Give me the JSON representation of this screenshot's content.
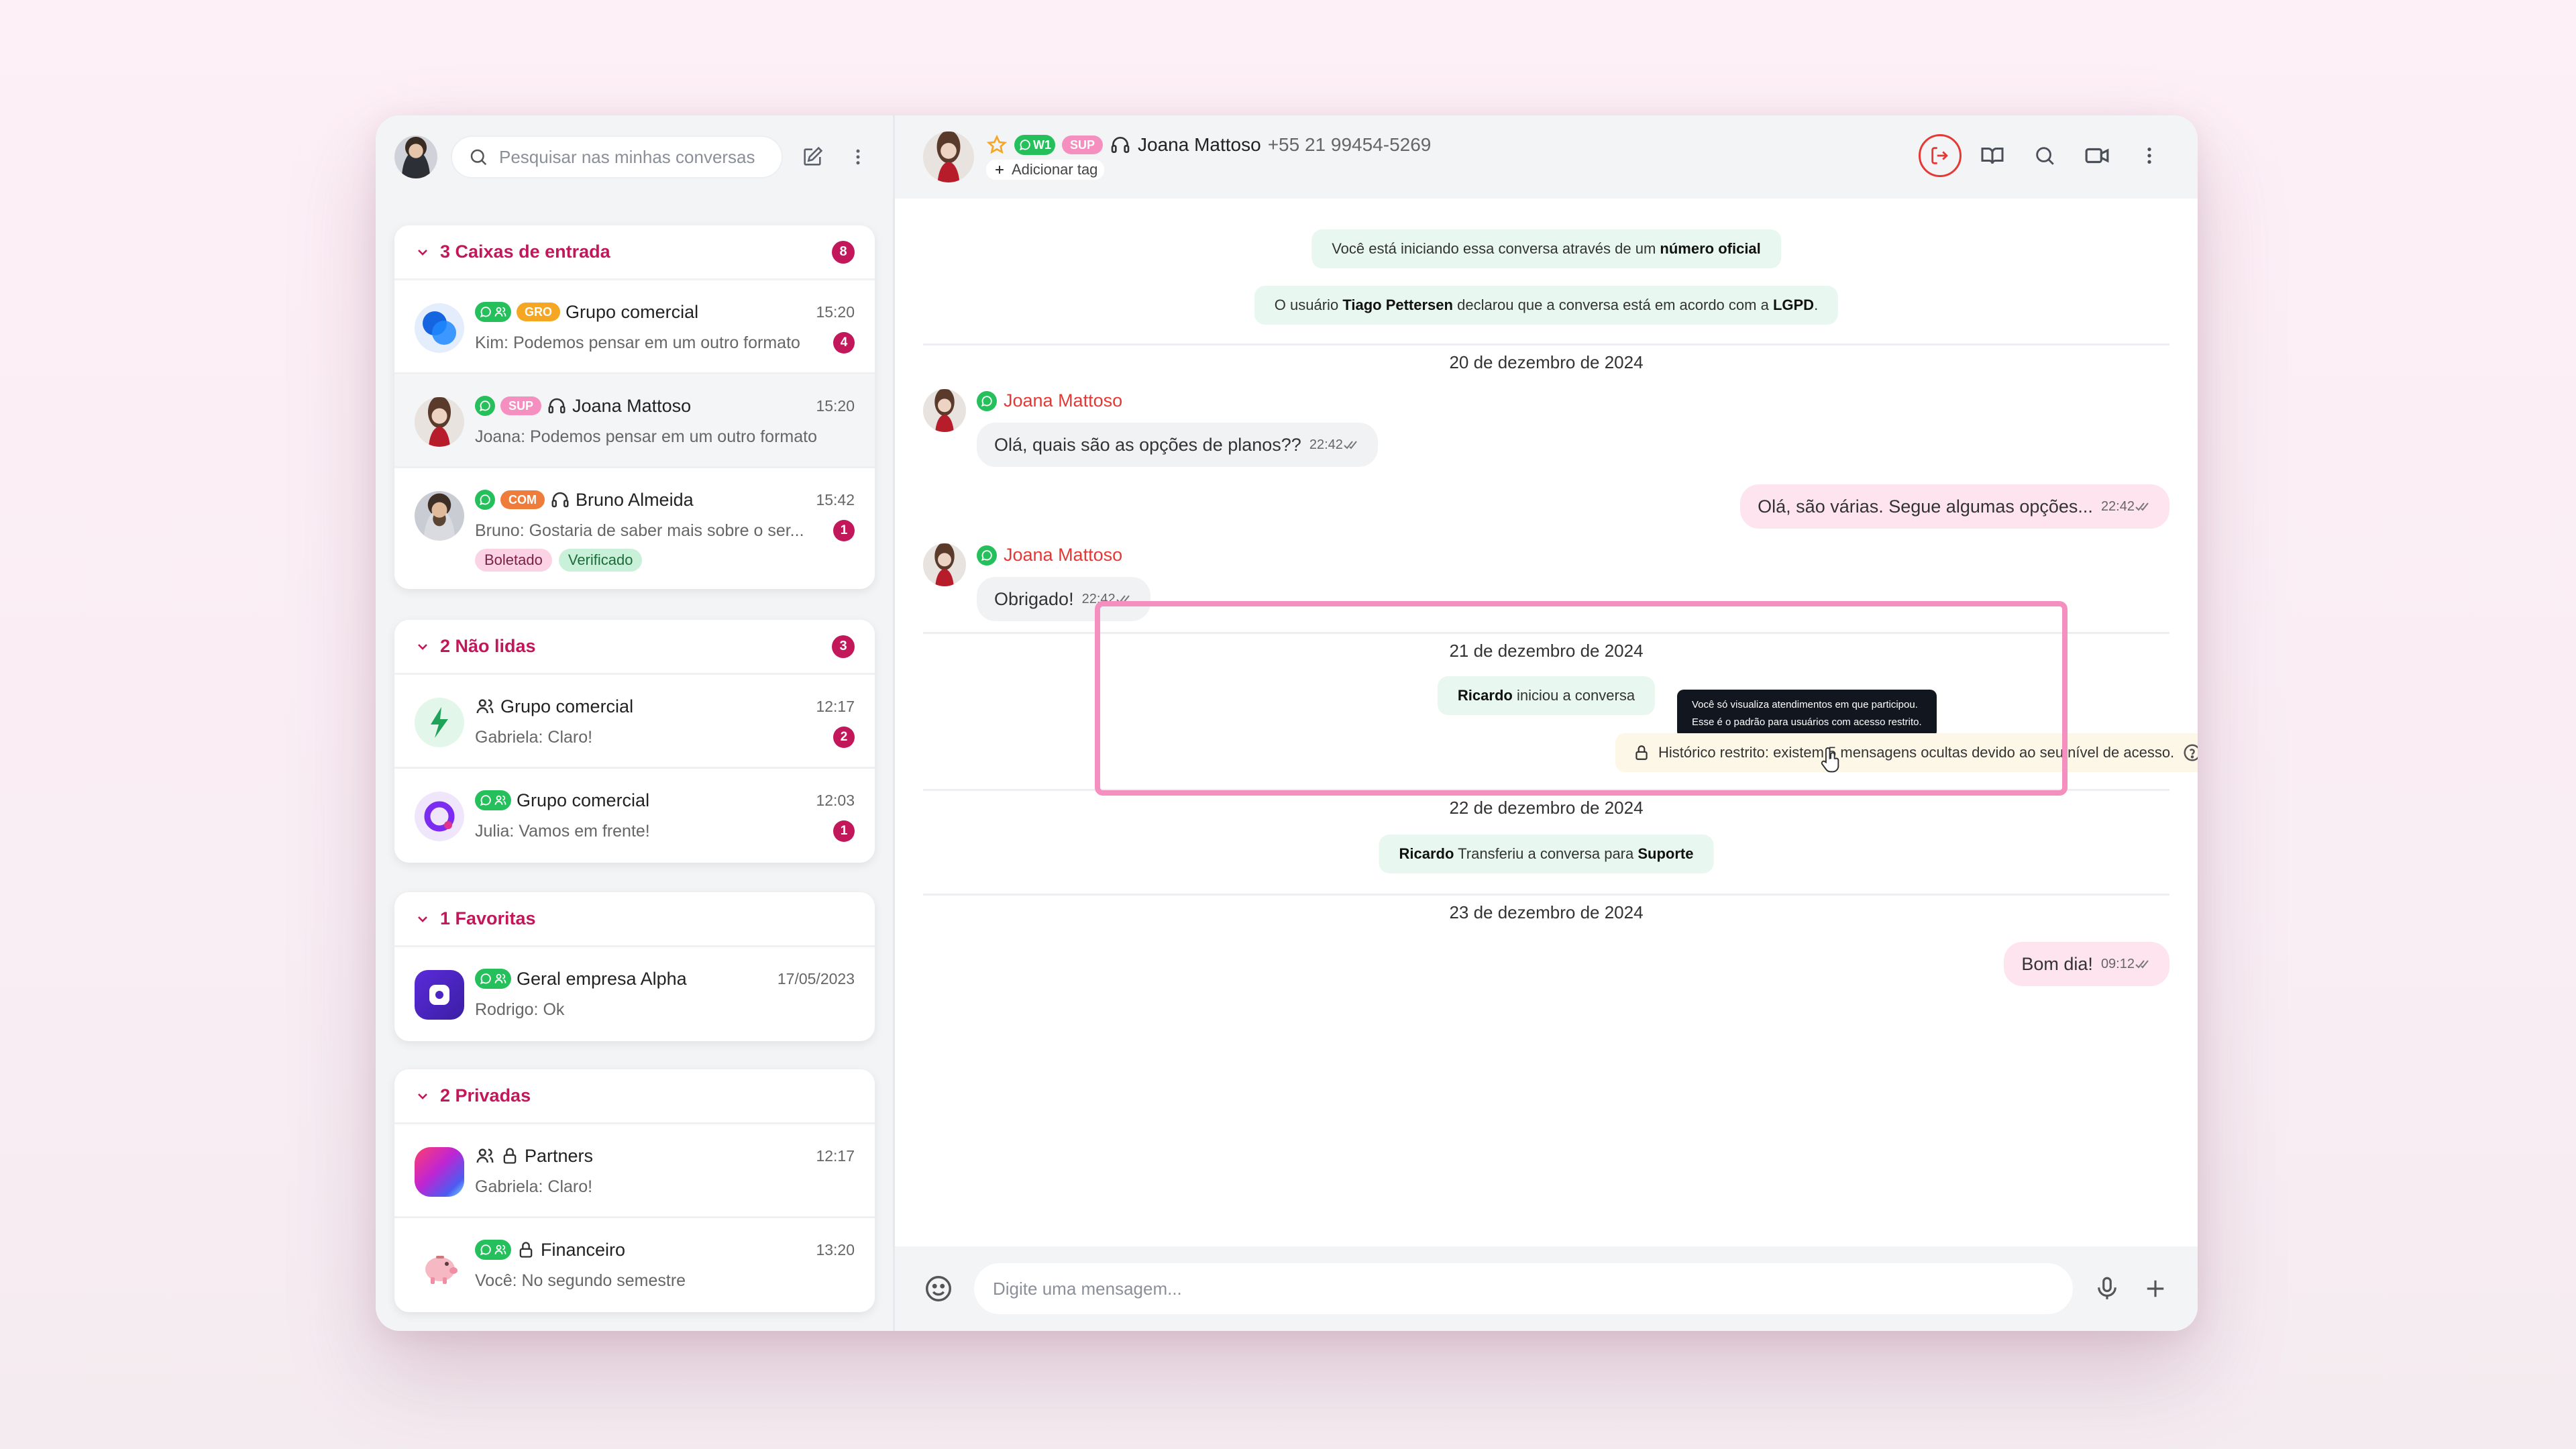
{
  "sidebar": {
    "search_placeholder": "Pesquisar nas minhas conversas",
    "groups": [
      {
        "title": "3 Caixas de entrada",
        "count": "8",
        "items": [
          {
            "name": "Grupo comercial",
            "time": "15:20",
            "preview": "Kim: Podemos pensar em um outro formato",
            "count": "4",
            "tag": "GRO"
          },
          {
            "name": "Joana Mattoso",
            "time": "15:20",
            "preview": "Joana: Podemos pensar em um outro formato",
            "tag": "SUP"
          },
          {
            "name": "Bruno Almeida",
            "time": "15:42",
            "preview": "Bruno: Gostaria de saber mais sobre o ser...",
            "count": "1",
            "tag": "COM",
            "chips": [
              "Boletado",
              "Verificado"
            ]
          }
        ]
      },
      {
        "title": "2 Não lidas",
        "count": "3",
        "items": [
          {
            "name": "Grupo comercial",
            "time": "12:17",
            "preview": "Gabriela: Claro!",
            "count": "2"
          },
          {
            "name": "Grupo comercial",
            "time": "12:03",
            "preview": "Julia: Vamos em frente!",
            "count": "1"
          }
        ]
      },
      {
        "title": "1 Favoritas",
        "items": [
          {
            "name": "Geral empresa Alpha",
            "time": "17/05/2023",
            "preview": "Rodrigo: Ok"
          }
        ]
      },
      {
        "title": "2 Privadas",
        "items": [
          {
            "name": "Partners",
            "time": "12:17",
            "preview": "Gabriela: Claro!"
          },
          {
            "name": "Financeiro",
            "time": "13:20",
            "preview": "Você: No segundo semestre"
          }
        ]
      }
    ]
  },
  "chat": {
    "contact_name": "Joana Mattoso",
    "contact_phone": "+55 21 99454-5269",
    "channel_tag": "W1",
    "dept_tag": "SUP",
    "add_tag": "Adicionar tag",
    "sys1_pre": "Você está iniciando essa conversa através de um",
    "sys1_bold": "número oficial",
    "sys2_pre": "O usuário",
    "sys2_bold": "Tiago Pettersen",
    "sys2_mid": "declarou que a conversa está em acordo com a",
    "sys2_bold2": "LGPD",
    "sys2_end": ".",
    "date1": "20 de dezembro de 2024",
    "sender1": "Joana Mattoso",
    "msg1": "Olá, quais são as opções de planos??",
    "msg1_time": "22:42",
    "msg2": "Olá, são várias. Segue algumas opções...",
    "msg2_time": "22:42",
    "sender2": "Joana Mattoso",
    "msg3": "Obrigado!",
    "msg3_time": "22:42",
    "date2": "21 de dezembro de 2024",
    "sys3_bold": "Ricardo",
    "sys3_rest": "iniciou a conversa",
    "tooltip_l1": "Você só visualiza atendimentos em que participou.",
    "tooltip_l2": "Esse é o padrão para usuários com acesso restrito.",
    "restricted": "Histórico restrito: existem 5 mensagens ocultas devido ao seu nível de acesso.",
    "date3": "22 de dezembro de 2024",
    "sys4_bold": "Ricardo",
    "sys4_mid": "Transferiu a conversa para",
    "sys4_bold2": "Suporte",
    "date4": "23 de dezembro de 2024",
    "msg4": "Bom dia!",
    "msg4_time": "09:12",
    "composer_placeholder": "Digite uma mensagem..."
  },
  "colors": {
    "accent": "#c2185b",
    "whatsapp": "#25c05b",
    "tag_gro": "#f5a623",
    "tag_sup": "#f48fbf",
    "tag_com": "#f07c3c",
    "highlight": "#f48fbf"
  }
}
